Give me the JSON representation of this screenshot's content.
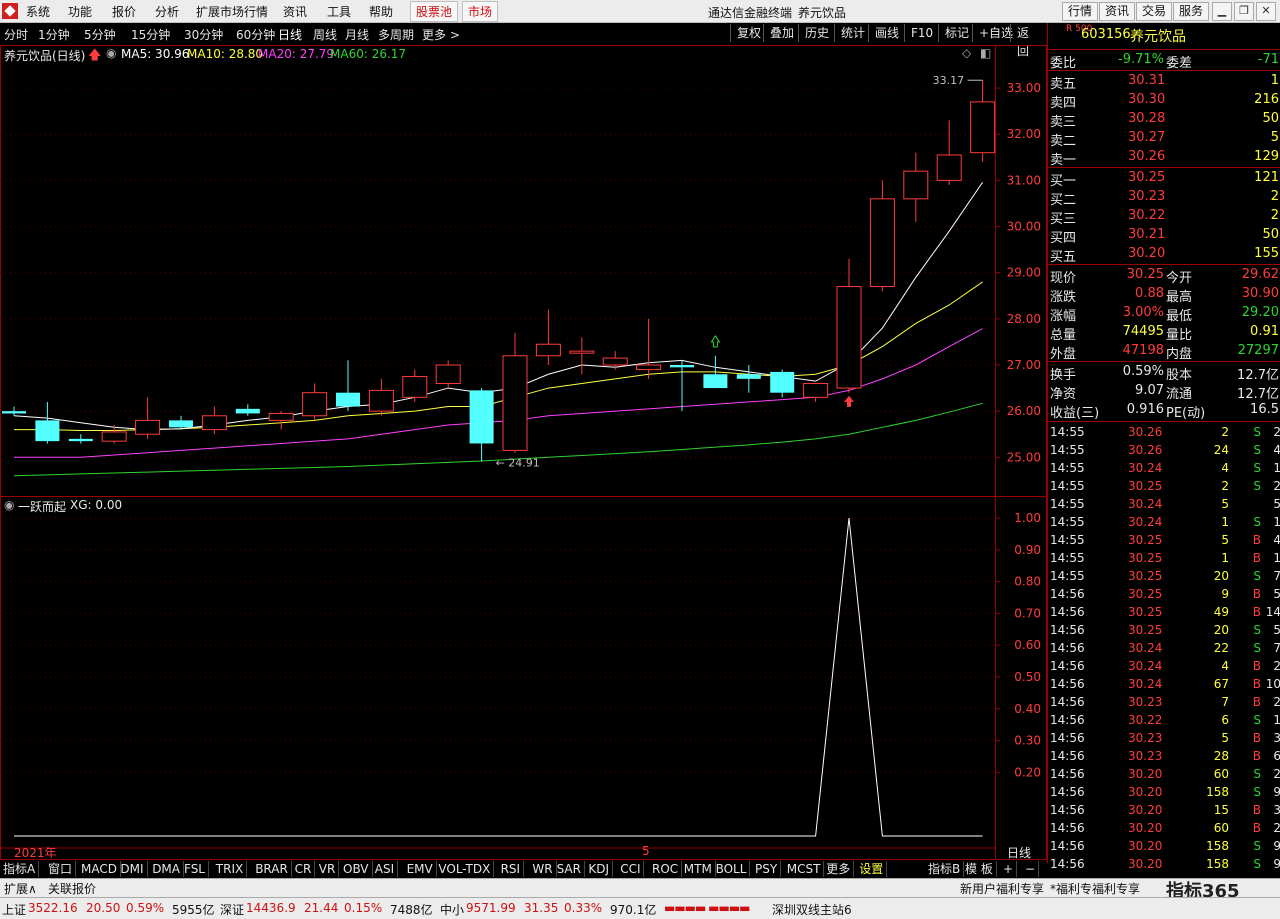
{
  "menu": {
    "items": [
      "系统",
      "功能",
      "报价",
      "分析",
      "扩展市场行情",
      "资讯",
      "工具",
      "帮助"
    ],
    "highlight": [
      "股票池",
      "市场"
    ],
    "window_title": "通达信金融终端",
    "stock_title": "养元饮品",
    "right_buttons": [
      "行情",
      "资讯",
      "交易",
      "服务"
    ]
  },
  "toolbar": {
    "periods": [
      "分时",
      "1分钟",
      "5分钟",
      "15分钟",
      "30分钟",
      "60分钟",
      "日线",
      "周线",
      "月线",
      "多周期",
      "更多 >"
    ],
    "selected": "日线",
    "right": [
      "复权",
      "叠加",
      "历史",
      "统计",
      "画线",
      "F10",
      "标记",
      "+自选",
      "返回"
    ]
  },
  "main_chart": {
    "label": "养元饮品(日线)",
    "ma": [
      {
        "name": "MA5: 30.96",
        "color": "#ffffff"
      },
      {
        "name": "MA10: 28.80",
        "color": "#ffff40"
      },
      {
        "name": "MA20: 27.79",
        "color": "#ff40ff"
      },
      {
        "name": "MA60: 26.17",
        "color": "#2fd42f"
      }
    ],
    "high_label": "33.17",
    "low_label": "24.91",
    "axis_ticks": [
      "33.00",
      "32.00",
      "31.00",
      "30.00",
      "29.00",
      "28.00",
      "27.00",
      "26.00",
      "25.00"
    ],
    "ylim": [
      24.4,
      33.5
    ]
  },
  "indicator_chart": {
    "label": "一跃而起",
    "value_label": "XG: 0.00",
    "axis_ticks": [
      "1.00",
      "0.90",
      "0.80",
      "0.70",
      "0.60",
      "0.50",
      "0.40",
      "0.30",
      "0.20"
    ],
    "date_left": "2021年",
    "date_mid": "5",
    "period_label": "日线"
  },
  "chart_data": {
    "type": "candlestick",
    "candles": [
      {
        "o": 26.0,
        "h": 26.1,
        "l": 25.9,
        "c": 25.95
      },
      {
        "o": 25.8,
        "h": 26.2,
        "l": 25.3,
        "c": 25.35
      },
      {
        "o": 25.4,
        "h": 25.5,
        "l": 25.3,
        "c": 25.35
      },
      {
        "o": 25.35,
        "h": 25.7,
        "l": 25.3,
        "c": 25.55
      },
      {
        "o": 25.5,
        "h": 26.3,
        "l": 25.4,
        "c": 25.8
      },
      {
        "o": 25.8,
        "h": 25.9,
        "l": 25.6,
        "c": 25.65
      },
      {
        "o": 25.6,
        "h": 26.1,
        "l": 25.5,
        "c": 25.9
      },
      {
        "o": 26.05,
        "h": 26.15,
        "l": 25.9,
        "c": 25.95
      },
      {
        "o": 25.8,
        "h": 26.0,
        "l": 25.6,
        "c": 25.95
      },
      {
        "o": 25.9,
        "h": 26.6,
        "l": 25.8,
        "c": 26.4
      },
      {
        "o": 26.4,
        "h": 27.1,
        "l": 26.0,
        "c": 26.1
      },
      {
        "o": 26.0,
        "h": 26.7,
        "l": 25.9,
        "c": 26.45
      },
      {
        "o": 26.3,
        "h": 26.9,
        "l": 26.2,
        "c": 26.75
      },
      {
        "o": 26.6,
        "h": 27.1,
        "l": 26.5,
        "c": 27.0
      },
      {
        "o": 26.45,
        "h": 26.5,
        "l": 24.91,
        "c": 25.3
      },
      {
        "o": 25.15,
        "h": 27.7,
        "l": 25.1,
        "c": 27.2
      },
      {
        "o": 27.2,
        "h": 28.2,
        "l": 27.0,
        "c": 27.45
      },
      {
        "o": 27.3,
        "h": 27.6,
        "l": 26.8,
        "c": 27.3
      },
      {
        "o": 27.0,
        "h": 27.3,
        "l": 26.9,
        "c": 27.15
      },
      {
        "o": 26.9,
        "h": 28.0,
        "l": 26.7,
        "c": 27.0
      },
      {
        "o": 27.0,
        "h": 27.1,
        "l": 26.0,
        "c": 26.95
      },
      {
        "o": 26.8,
        "h": 27.2,
        "l": 26.5,
        "c": 26.5
      },
      {
        "o": 26.8,
        "h": 27.0,
        "l": 26.4,
        "c": 26.7
      },
      {
        "o": 26.85,
        "h": 26.9,
        "l": 26.3,
        "c": 26.4
      },
      {
        "o": 26.3,
        "h": 26.6,
        "l": 26.2,
        "c": 26.6
      },
      {
        "o": 26.5,
        "h": 29.3,
        "l": 26.4,
        "c": 28.7
      },
      {
        "o": 28.7,
        "h": 31.0,
        "l": 28.6,
        "c": 30.6
      },
      {
        "o": 30.6,
        "h": 31.6,
        "l": 30.1,
        "c": 31.2
      },
      {
        "o": 31.0,
        "h": 32.3,
        "l": 30.9,
        "c": 31.55
      },
      {
        "o": 31.6,
        "h": 33.17,
        "l": 31.4,
        "c": 32.7
      }
    ],
    "ma5": [
      25.9,
      25.85,
      25.75,
      25.65,
      25.6,
      25.62,
      25.7,
      25.8,
      25.88,
      26.0,
      26.1,
      26.15,
      26.3,
      26.5,
      26.4,
      26.5,
      26.8,
      27.0,
      26.95,
      27.05,
      27.1,
      26.95,
      26.85,
      26.75,
      26.65,
      27.05,
      27.8,
      28.9,
      29.9,
      30.96
    ],
    "ma10": [
      25.6,
      25.6,
      25.58,
      25.58,
      25.6,
      25.62,
      25.65,
      25.7,
      25.75,
      25.8,
      25.9,
      25.95,
      26.0,
      26.1,
      26.1,
      26.3,
      26.5,
      26.6,
      26.7,
      26.8,
      26.85,
      26.85,
      26.8,
      26.75,
      26.8,
      27.0,
      27.4,
      27.9,
      28.3,
      28.8
    ],
    "ma20": [
      25.0,
      25.0,
      25.0,
      25.05,
      25.1,
      25.15,
      25.2,
      25.25,
      25.3,
      25.35,
      25.4,
      25.5,
      25.6,
      25.7,
      25.75,
      25.8,
      25.9,
      25.95,
      26.0,
      26.05,
      26.1,
      26.15,
      26.2,
      26.25,
      26.3,
      26.45,
      26.7,
      27.0,
      27.4,
      27.79
    ],
    "ma60": [
      24.6,
      24.62,
      24.64,
      24.66,
      24.68,
      24.7,
      24.72,
      24.74,
      24.76,
      24.78,
      24.8,
      24.83,
      24.86,
      24.89,
      24.92,
      24.96,
      25.0,
      25.04,
      25.08,
      25.12,
      25.17,
      25.22,
      25.27,
      25.33,
      25.4,
      25.5,
      25.65,
      25.8,
      25.98,
      26.17
    ],
    "signal": [
      0,
      0,
      0,
      0,
      0,
      0,
      0,
      0,
      0,
      0,
      0,
      0,
      0,
      0,
      0,
      0,
      0,
      0,
      0,
      0,
      0,
      0,
      0,
      0,
      0,
      1,
      0,
      0,
      0,
      0
    ]
  },
  "quote": {
    "code": "603156",
    "name": "养元饮品",
    "tag": "R 500",
    "ratio_label": "委比",
    "ratio": "-9.71%",
    "diff_label": "委差",
    "diff": "-71",
    "asks": [
      {
        "label": "卖五",
        "price": "30.31",
        "vol": "1"
      },
      {
        "label": "卖四",
        "price": "30.30",
        "vol": "216"
      },
      {
        "label": "卖三",
        "price": "30.28",
        "vol": "50"
      },
      {
        "label": "卖二",
        "price": "30.27",
        "vol": "5"
      },
      {
        "label": "卖一",
        "price": "30.26",
        "vol": "129"
      }
    ],
    "bids": [
      {
        "label": "买一",
        "price": "30.25",
        "vol": "121"
      },
      {
        "label": "买二",
        "price": "30.23",
        "vol": "2"
      },
      {
        "label": "买三",
        "price": "30.22",
        "vol": "2"
      },
      {
        "label": "买四",
        "price": "30.21",
        "vol": "50"
      },
      {
        "label": "买五",
        "price": "30.20",
        "vol": "155"
      }
    ],
    "stats1": [
      {
        "l": "现价",
        "v": "30.25",
        "vc": "red",
        "l2": "今开",
        "v2": "29.62",
        "v2c": "red"
      },
      {
        "l": "涨跌",
        "v": "0.88",
        "vc": "red",
        "l2": "最高",
        "v2": "30.90",
        "v2c": "red"
      },
      {
        "l": "涨幅",
        "v": "3.00%",
        "vc": "red",
        "l2": "最低",
        "v2": "29.20",
        "v2c": "green"
      },
      {
        "l": "总量",
        "v": "74495",
        "vc": "yellow",
        "l2": "量比",
        "v2": "0.91",
        "v2c": "yellow"
      },
      {
        "l": "外盘",
        "v": "47198",
        "vc": "red",
        "l2": "内盘",
        "v2": "27297",
        "v2c": "green"
      }
    ],
    "stats2": [
      {
        "l": "换手",
        "v": "0.59%",
        "l2": "股本",
        "v2": "12.7亿"
      },
      {
        "l": "净资",
        "v": "9.07",
        "l2": "流通",
        "v2": "12.7亿"
      },
      {
        "l": "收益(三)",
        "v": "0.916",
        "l2": "PE(动)",
        "v2": "16.5"
      }
    ],
    "ticks": [
      {
        "t": "14:55",
        "p": "30.26",
        "v": "2",
        "s": "S",
        "n": "2"
      },
      {
        "t": "14:55",
        "p": "30.26",
        "v": "24",
        "s": "S",
        "n": "4"
      },
      {
        "t": "14:55",
        "p": "30.24",
        "v": "4",
        "s": "S",
        "n": "1"
      },
      {
        "t": "14:55",
        "p": "30.25",
        "v": "2",
        "s": "S",
        "n": "2"
      },
      {
        "t": "14:55",
        "p": "30.24",
        "v": "5",
        "s": "",
        "n": "5"
      },
      {
        "t": "14:55",
        "p": "30.24",
        "v": "1",
        "s": "S",
        "n": "1"
      },
      {
        "t": "14:55",
        "p": "30.25",
        "v": "5",
        "s": "B",
        "n": "4"
      },
      {
        "t": "14:55",
        "p": "30.25",
        "v": "1",
        "s": "B",
        "n": "1"
      },
      {
        "t": "14:55",
        "p": "30.25",
        "v": "20",
        "s": "S",
        "n": "7"
      },
      {
        "t": "14:56",
        "p": "30.25",
        "v": "9",
        "s": "B",
        "n": "5"
      },
      {
        "t": "14:56",
        "p": "30.25",
        "v": "49",
        "s": "B",
        "n": "14"
      },
      {
        "t": "14:56",
        "p": "30.25",
        "v": "20",
        "s": "S",
        "n": "5"
      },
      {
        "t": "14:56",
        "p": "30.24",
        "v": "22",
        "s": "S",
        "n": "7"
      },
      {
        "t": "14:56",
        "p": "30.24",
        "v": "4",
        "s": "B",
        "n": "2"
      },
      {
        "t": "14:56",
        "p": "30.24",
        "v": "67",
        "s": "B",
        "n": "10"
      },
      {
        "t": "14:56",
        "p": "30.23",
        "v": "7",
        "s": "B",
        "n": "2"
      },
      {
        "t": "14:56",
        "p": "30.22",
        "v": "6",
        "s": "S",
        "n": "1"
      },
      {
        "t": "14:56",
        "p": "30.23",
        "v": "5",
        "s": "B",
        "n": "3"
      },
      {
        "t": "14:56",
        "p": "30.23",
        "v": "28",
        "s": "B",
        "n": "6"
      },
      {
        "t": "14:56",
        "p": "30.20",
        "v": "60",
        "s": "S",
        "n": "2"
      },
      {
        "t": "14:56",
        "p": "30.20",
        "v": "158",
        "s": "S",
        "n": "9"
      },
      {
        "t": "14:56",
        "p": "30.20",
        "v": "15",
        "s": "B",
        "n": "3"
      },
      {
        "t": "14:56",
        "p": "30.20",
        "v": "60",
        "s": "B",
        "n": "2"
      },
      {
        "t": "14:56",
        "p": "30.20",
        "v": "158",
        "s": "S",
        "n": "9"
      },
      {
        "t": "14:56",
        "p": "30.20",
        "v": "158",
        "s": "S",
        "n": "9"
      }
    ]
  },
  "tabs": [
    "指标A",
    "窗口",
    "MACD",
    "DMI",
    "DMA",
    "FSL",
    "TRIX",
    "BRAR",
    "CR",
    "VR",
    "OBV",
    "ASI",
    "EMV",
    "VOL-TDX",
    "RSI",
    "WR",
    "SAR",
    "KDJ",
    "CCI",
    "ROC",
    "MTM",
    "BOLL",
    "PSY",
    "MCST",
    "更多",
    "设置"
  ],
  "tabs_right": [
    "指标B",
    "模 板",
    "+",
    "−"
  ],
  "tabs2": [
    "扩展∧",
    "关联报价"
  ],
  "tabs2_right": [
    "新用户福利专享",
    "*福利专福利专享",
    "指标365"
  ],
  "status": [
    {
      "name": "上证",
      "v1": "3522.16",
      "v2": "20.50",
      "v3": "0.59%",
      "v4": "5955亿"
    },
    {
      "name": "深证",
      "v1": "14436.9",
      "v2": "21.44",
      "v3": "0.15%",
      "v4": "7488亿"
    },
    {
      "name": "中小",
      "v1": "9571.99",
      "v2": "31.35",
      "v3": "0.33%",
      "v4": "970.1亿"
    }
  ],
  "status_right": "深圳双线主站6"
}
